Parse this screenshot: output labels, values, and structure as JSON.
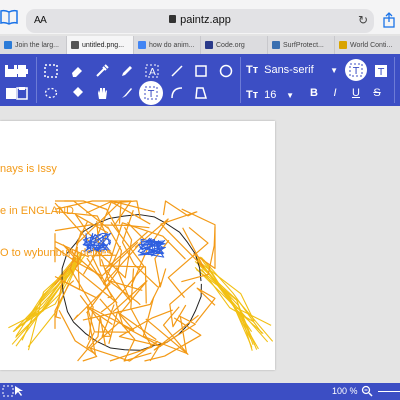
{
  "browser": {
    "aa_label": "AA",
    "url": "paintz.app",
    "tabs": [
      {
        "label": "Join the larg...",
        "icon_color": "#2b7bd8",
        "active": false
      },
      {
        "label": "untitled.png...",
        "icon_color": "#555555",
        "active": true
      },
      {
        "label": "how do anim...",
        "icon_color": "#4285f4",
        "active": false
      },
      {
        "label": "Code.org",
        "icon_color": "#2a3a8a",
        "active": false
      },
      {
        "label": "SurfProtect...",
        "icon_color": "#3a6fb0",
        "active": false
      },
      {
        "label": "World Conti...",
        "icon_color": "#d9a400",
        "active": false
      }
    ]
  },
  "toolbar": {
    "accent": "#3c4ec4",
    "icons_row1": [
      "save-icon",
      "print-icon",
      "select-rect-icon",
      "eraser-icon",
      "eyedropper-icon",
      "pencil-icon",
      "text-tool-icon",
      "line-icon",
      "rectangle-icon",
      "ellipse-icon"
    ],
    "icons_row2": [
      "clipboard-icon",
      "paste-icon",
      "select-free-icon",
      "fill-icon",
      "pan-hand-icon",
      "brush-icon",
      "text-box-icon",
      "curve-icon",
      "polygon-icon"
    ],
    "font_family": "Sans-serif",
    "font_size": "16",
    "format_buttons": [
      "B",
      "I",
      "U",
      "S"
    ]
  },
  "canvas": {
    "text_lines": [
      "nays is Issy",
      "e in ENGLAND",
      "O to wybunbury delves"
    ],
    "text_color": "#f39a17",
    "scribble_orange": "#f39a17",
    "scribble_yellow": "#f2c014",
    "scribble_blue": "#2e5fe0"
  },
  "statusbar": {
    "zoom": "100 %"
  }
}
